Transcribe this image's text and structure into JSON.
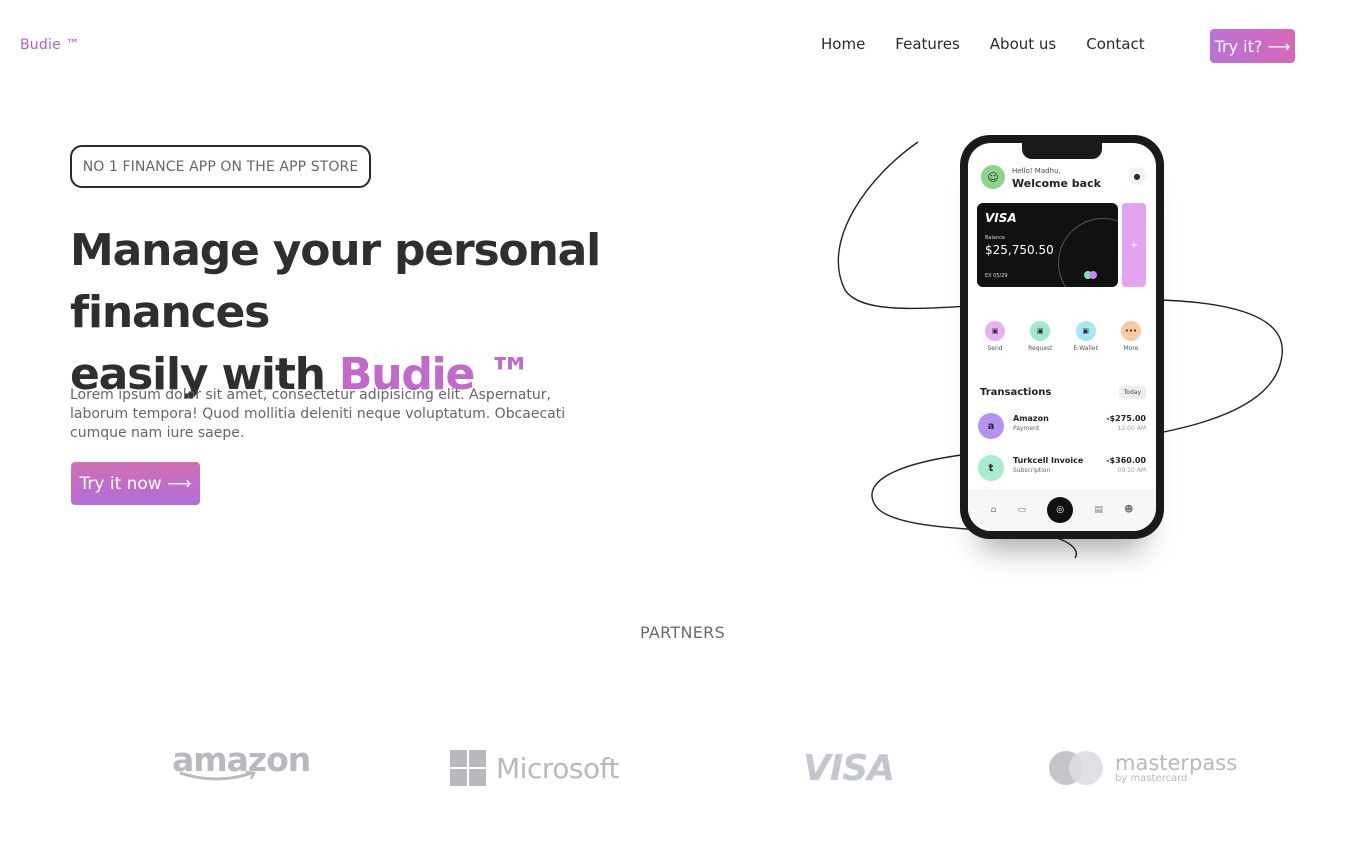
{
  "header": {
    "logo": "Budie ™",
    "nav": [
      "Home",
      "Features",
      "About us",
      "Contact"
    ],
    "cta": "Try it? ⟶"
  },
  "hero": {
    "badge": "NO 1 FINANCE APP ON THE APP STORE",
    "headline_line1": "Manage your personal finances",
    "headline_line2_prefix": "easily with ",
    "headline_brand": "Budie ™",
    "description": "Lorem ipsum dolor sit amet, consectetur adipisicing elit. Aspernatur, laborum tempora! Quod mollitia deleniti neque voluptatum. Obcaecati cumque nam iure saepe.",
    "cta": "Try it now ⟶"
  },
  "phone": {
    "greeting": "Hello! Madhu,",
    "welcome": "Welcome back",
    "card": {
      "brand": "VISA",
      "balance_label": "Balance",
      "balance": "$25,750.50",
      "expiry": "EX  05/29"
    },
    "add": "+",
    "actions": [
      {
        "label": "Send",
        "color": "#e7b1f4"
      },
      {
        "label": "Request",
        "color": "#9fe8c9"
      },
      {
        "label": "E-Wallet",
        "color": "#a6e7f2"
      },
      {
        "label": "More",
        "color": "#f9c9a4"
      }
    ],
    "transactions_title": "Transactions",
    "filter": "Today",
    "transactions": [
      {
        "icon": "a",
        "name": "Amazon",
        "sub": "Payment",
        "amount": "-$275.00",
        "time": "12:00 AM",
        "color": "#b493f0"
      },
      {
        "icon": "t",
        "name": "Turkcell Invoice",
        "sub": "Subscription",
        "amount": "-$360.00",
        "time": "09.10 AM",
        "color": "#a8ebcf"
      }
    ]
  },
  "partners": {
    "title": "PARTNERS",
    "logos": {
      "amazon": "amazon",
      "microsoft": "Microsoft",
      "visa": "VISA",
      "masterpass": "masterpass",
      "masterpass_sub": "by mastercard"
    }
  },
  "colors": {
    "brand": "#c06ac9",
    "gradient_start": "#d46fb7",
    "gradient_end": "#b06ed8",
    "text": "#2f2f2f"
  }
}
